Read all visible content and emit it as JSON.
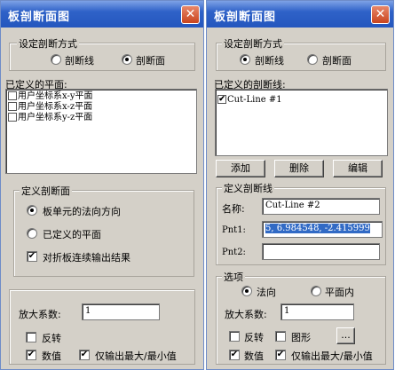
{
  "left_dialog": {
    "title": "板剖断面图",
    "close": "✕",
    "method_group": "设定剖断方式",
    "radio_line": "剖断线",
    "radio_section": "剖断面",
    "defined_planes_label": "已定义的平面:",
    "planes": [
      "用户坐标系x-y平面",
      "用户坐标系x-z平面",
      "用户坐标系y-z平面"
    ],
    "define_group": "定义剖断面",
    "opt_normal": "板单元的法向方向",
    "opt_defined": "已定义的平面",
    "opt_fold": "对折板连续输出结果",
    "zoom_label": "放大系数:",
    "zoom_value": "1",
    "reverse": "反转",
    "numeric": "数值",
    "maxmin": "仅输出最大/最小值"
  },
  "right_dialog": {
    "title": "板剖断面图",
    "close": "✕",
    "method_group": "设定剖断方式",
    "radio_line": "剖断线",
    "radio_section": "剖断面",
    "defined_lines_label": "已定义的剖断线:",
    "lines": [
      "Cut-Line #1"
    ],
    "btn_add": "添加",
    "btn_delete": "删除",
    "btn_edit": "编辑",
    "define_group": "定义剖断线",
    "name_label": "名称:",
    "name_value": "Cut-Line #2",
    "pnt1_label": "Pnt1:",
    "pnt1_value": "5, 6.984548, -2.415999",
    "pnt2_label": "Pnt2:",
    "pnt2_value": "",
    "options_group": "选项",
    "opt_normal": "法向",
    "opt_inplane": "平面内",
    "zoom_label": "放大系数:",
    "zoom_value": "1",
    "reverse": "反转",
    "graphic": "图形",
    "more": "...",
    "numeric": "数值",
    "maxmin": "仅输出最大/最小值"
  },
  "check_mark": "✔"
}
